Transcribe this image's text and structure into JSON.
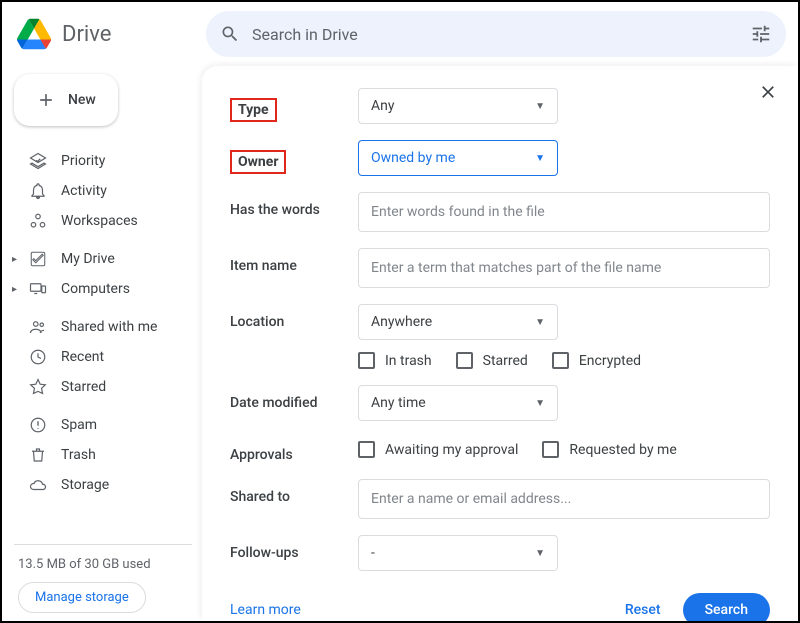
{
  "header": {
    "app_name": "Drive",
    "search_placeholder": "Search in Drive"
  },
  "sidebar": {
    "new_label": "New",
    "groups": [
      [
        {
          "label": "Priority"
        },
        {
          "label": "Activity"
        },
        {
          "label": "Workspaces"
        }
      ],
      [
        {
          "label": "My Drive"
        },
        {
          "label": "Computers"
        }
      ],
      [
        {
          "label": "Shared with me"
        },
        {
          "label": "Recent"
        },
        {
          "label": "Starred"
        }
      ],
      [
        {
          "label": "Spam"
        },
        {
          "label": "Trash"
        },
        {
          "label": "Storage"
        }
      ]
    ],
    "storage_text": "13.5 MB of 30 GB used",
    "manage_label": "Manage storage"
  },
  "panel": {
    "fields": {
      "type": {
        "label": "Type",
        "value": "Any"
      },
      "owner": {
        "label": "Owner",
        "value": "Owned by me"
      },
      "has_words": {
        "label": "Has the words",
        "placeholder": "Enter words found in the file"
      },
      "item_name": {
        "label": "Item name",
        "placeholder": "Enter a term that matches part of the file name"
      },
      "location": {
        "label": "Location",
        "value": "Anywhere"
      },
      "location_checks": {
        "in_trash": "In trash",
        "starred": "Starred",
        "encrypted": "Encrypted"
      },
      "date_modified": {
        "label": "Date modified",
        "value": "Any time"
      },
      "approvals": {
        "label": "Approvals",
        "awaiting": "Awaiting my approval",
        "requested": "Requested by me"
      },
      "shared_to": {
        "label": "Shared to",
        "placeholder": "Enter a name or email address..."
      },
      "followups": {
        "label": "Follow-ups",
        "value": "-"
      }
    },
    "footer": {
      "learn_more": "Learn more",
      "reset": "Reset",
      "search": "Search"
    }
  }
}
